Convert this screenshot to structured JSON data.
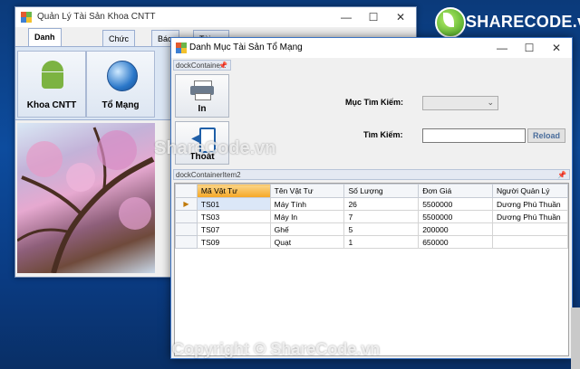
{
  "desktop": {
    "logo_text": "SHARECODE.vn",
    "watermark_center": "ShareCode.vn",
    "copyright": "Copyright © ShareCode.vn"
  },
  "main_window": {
    "title": "Quản Lý Tài Sản Khoa CNTT",
    "tabs": [
      "Danh Mục Tài Sản",
      "Chức Năng",
      "Báo Cáo",
      "Tài Khoản"
    ],
    "ribbon_buttons": [
      {
        "label": "Khoa CNTT",
        "icon": "android-icon"
      },
      {
        "label": "Tổ Mạng",
        "icon": "globe-icon"
      }
    ]
  },
  "dialog": {
    "title": "Danh Mục Tài Sản Tổ Mạng",
    "dock_top_title": "dockContaine...",
    "dock_bottom_title": "dockContainerItem2",
    "buttons": {
      "print": "In",
      "exit": "Thoát"
    },
    "search": {
      "category_label": "Mục Tìm Kiếm:",
      "category_value": "",
      "keyword_label": "Tìm Kiếm:",
      "keyword_value": "",
      "reload_label": "Reload"
    },
    "grid": {
      "columns": [
        "Mã Vật Tư",
        "Tên Vật Tư",
        "Số Lượng",
        "Đơn Giá",
        "Người Quản Lý"
      ],
      "rows": [
        [
          "TS01",
          "Máy Tính",
          "26",
          "5500000",
          "Dương Phú Thuần"
        ],
        [
          "TS03",
          "Máy In",
          "7",
          "5500000",
          "Dương Phú Thuần"
        ],
        [
          "TS07",
          "Ghế",
          "5",
          "200000",
          ""
        ],
        [
          "TS09",
          "Quạt",
          "1",
          "650000",
          ""
        ]
      ]
    }
  },
  "colors": {
    "desktop_blue": "#0d4c9e",
    "active_column_header": "#f5a623",
    "selection": "#dbe7f7",
    "reload_text": "#4a6d9c"
  }
}
